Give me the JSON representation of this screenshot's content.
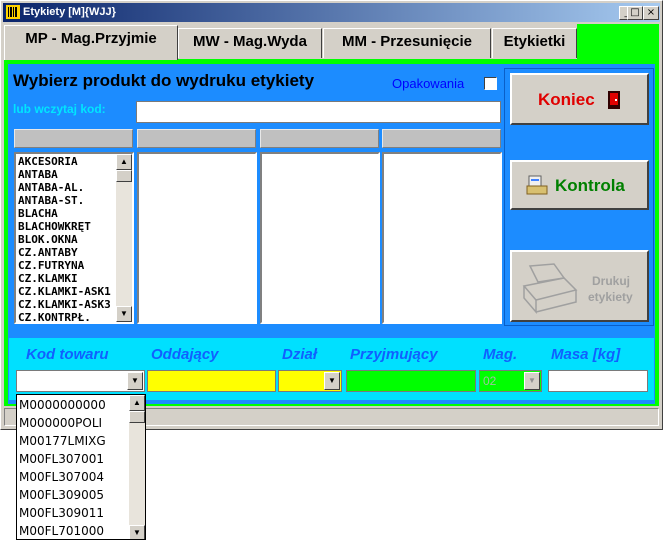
{
  "window": {
    "title": "Etykiety [M]{WJJ}"
  },
  "titlebar_buttons": {
    "minimize": "_",
    "maximize": "□",
    "close": "×"
  },
  "tabs": [
    {
      "label": "MP - Mag.Przyjmie"
    },
    {
      "label": "MW - Mag.Wyda"
    },
    {
      "label": "MM - Przesunięcie"
    },
    {
      "label": "Etykietki"
    }
  ],
  "main": {
    "heading": "Wybierz produkt do wydruku etykiety",
    "opakowania_label": "Opakowania",
    "code_label": "lub wczytaj kod:",
    "code_value": "",
    "product_list": [
      "AKCESORIA",
      "ANTABA",
      "ANTABA-AL.",
      "ANTABA-ST.",
      "BLACHA",
      "BLACHOWKRĘT",
      "BLOK.OKNA",
      "CZ.ANTABY",
      "CZ.FUTRYNA",
      "CZ.KLAMKI",
      "CZ.KLAMKI-ASK1",
      "CZ.KLAMKI-ASK3",
      "CZ.KONTRPŁ."
    ]
  },
  "buttons": {
    "koniec": "Koniec",
    "kontrola": "Kontrola",
    "drukuj_line1": "Drukuj",
    "drukuj_line2": "etykiety"
  },
  "bottom": {
    "labels": {
      "kod_towaru": "Kod towaru",
      "oddajacy": "Oddający",
      "dzial": "Dział",
      "przyjmujacy": "Przyjmujący",
      "mag": "Mag.",
      "masa": "Masa [kg]"
    },
    "mag_value": "02",
    "dropdown_items": [
      "M0000000000",
      "M000000POLI",
      "M00177LMIXG",
      "M00FL307001",
      "M00FL307004",
      "M00FL309005",
      "M00FL309011",
      "M00FL701000"
    ]
  },
  "colors": {
    "panel_blue": "#1c8cff",
    "frame_green": "#00ff00",
    "cyan": "#00e0ff",
    "yellow_field": "#ffff00",
    "green_field": "#00ff00",
    "koniec_red": "#e00000",
    "kontrola_green": "#008000"
  },
  "icons": {
    "app": "barcode-app-icon",
    "koniec": "red-door-icon",
    "kontrola": "scanner-icon",
    "drukuj": "printer-icon"
  }
}
